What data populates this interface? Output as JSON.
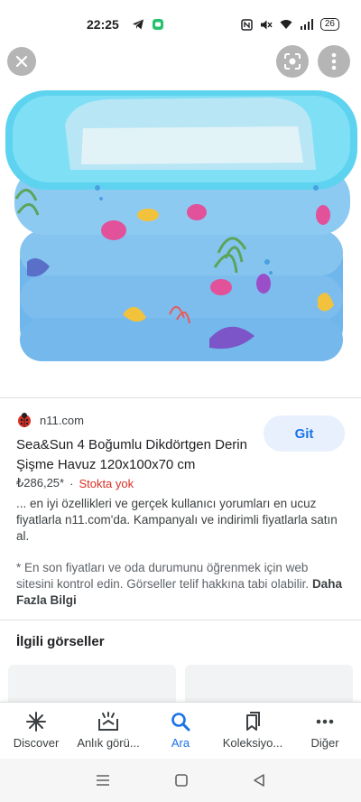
{
  "status": {
    "time": "22:25",
    "battery": "26"
  },
  "image": {
    "alt_colors": {
      "pool_blue": "#7cc3ef",
      "rim_light": "#bfe9f8",
      "accent": "#1a73e8"
    }
  },
  "source": {
    "name": "n11.com",
    "go_label": "Git"
  },
  "product": {
    "title": "Sea&Sun 4 Boğumlu Dikdörtgen Derin Şişme Havuz 120x100x70 cm",
    "price": "₺286,25*",
    "separator": "·",
    "stock": "Stokta yok",
    "description": "... en iyi özellikleri ve gerçek kullanıcı yorumları en ucuz fiyatlarla n11.com'da. Kampanyalı ve indirimli fiyatlarla satın al.",
    "note": "* En son fiyatları ve oda durumunu öğrenmek için web sitesini kontrol edin. Görseller telif hakkına tabi olabilir.",
    "more_link": "Daha Fazla Bilgi"
  },
  "related": {
    "title": "İlgili görseller"
  },
  "bottom_nav": [
    {
      "label": "Discover",
      "icon": "asterisk-icon"
    },
    {
      "label": "Anlık görü...",
      "icon": "snapshot-icon"
    },
    {
      "label": "Ara",
      "icon": "search-icon"
    },
    {
      "label": "Koleksiyo...",
      "icon": "bookmark-icon"
    },
    {
      "label": "Diğer",
      "icon": "more-horizontal-icon"
    }
  ]
}
